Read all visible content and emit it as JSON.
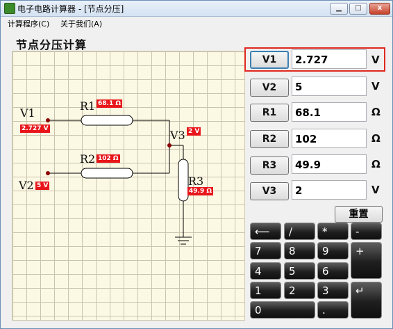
{
  "window": {
    "title": "电子电路计算器 - [节点分压]",
    "minimize_label": "▁",
    "maximize_label": "□",
    "close_label": "x"
  },
  "menu": [
    "计算程序(C)",
    "关于我们(A)"
  ],
  "heading": "节点分压计算",
  "circuit": {
    "v1_name": "V1",
    "v1_value": "2.727 V",
    "v2_name": "V2",
    "v2_value": "5 V",
    "v3_name": "V3",
    "v3_value": "2 V",
    "r1_name": "R1",
    "r1_value": "68.1 Ω",
    "r2_name": "R2",
    "r2_value": "102 Ω",
    "r3_name": "R3",
    "r3_value": "49.9 Ω"
  },
  "fields": [
    {
      "button": "V1",
      "value": "2.727",
      "unit": "V"
    },
    {
      "button": "V2",
      "value": "5",
      "unit": "V"
    },
    {
      "button": "R1",
      "value": "68.1",
      "unit": "Ω"
    },
    {
      "button": "R2",
      "value": "102",
      "unit": "Ω"
    },
    {
      "button": "R3",
      "value": "49.9",
      "unit": "Ω"
    },
    {
      "button": "V3",
      "value": "2",
      "unit": "V"
    }
  ],
  "reset_label": "重置",
  "keypad": {
    "backspace": "⟵",
    "divide": "/",
    "multiply": "*",
    "minus": "-",
    "k7": "7",
    "k8": "8",
    "k9": "9",
    "plus": "+",
    "k4": "4",
    "k5": "5",
    "k6": "6",
    "k1": "1",
    "k2": "2",
    "k3": "3",
    "enter": "↵",
    "k0": "0",
    "dot": "."
  },
  "colors": {
    "label_red": "#e8161b",
    "highlight_red": "#e0281f",
    "grid_bg": "#fbf8e3"
  }
}
